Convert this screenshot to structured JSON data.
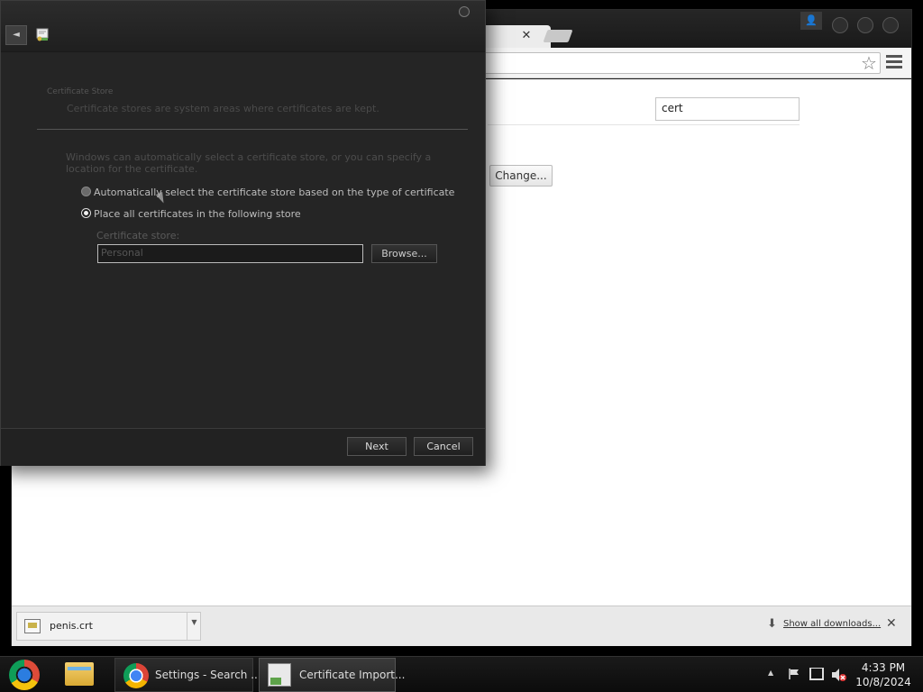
{
  "browser": {
    "search_value": "cert",
    "change_button": "Change...",
    "downloads": {
      "file_name": "penis.crt",
      "show_all": "Show all downloads...",
      "close": "✕"
    },
    "tab_close": "✕",
    "star_icon": "star-icon",
    "user_icon": "👤"
  },
  "wizard": {
    "back_icon": "◄",
    "heading": "Certificate Store",
    "subheading": "Certificate stores are system areas where certificates are kept.",
    "description": "Windows can automatically select a certificate store, or you can specify a location for the certificate.",
    "options": [
      {
        "label": "Automatically select the certificate store based on the type of certificate",
        "checked": false
      },
      {
        "label": "Place all certificates in the following store",
        "checked": true
      }
    ],
    "store_label": "Certificate store:",
    "store_value": "Personal",
    "browse_button": "Browse...",
    "next_button": "Next",
    "cancel_button": "Cancel"
  },
  "taskbar": {
    "tasks": [
      {
        "label": "Settings - Search ...",
        "icon": "chrome-icon"
      },
      {
        "label": "Certificate Import...",
        "icon": "certificate-icon"
      }
    ],
    "time": "4:33 PM",
    "date": "10/8/2024"
  }
}
